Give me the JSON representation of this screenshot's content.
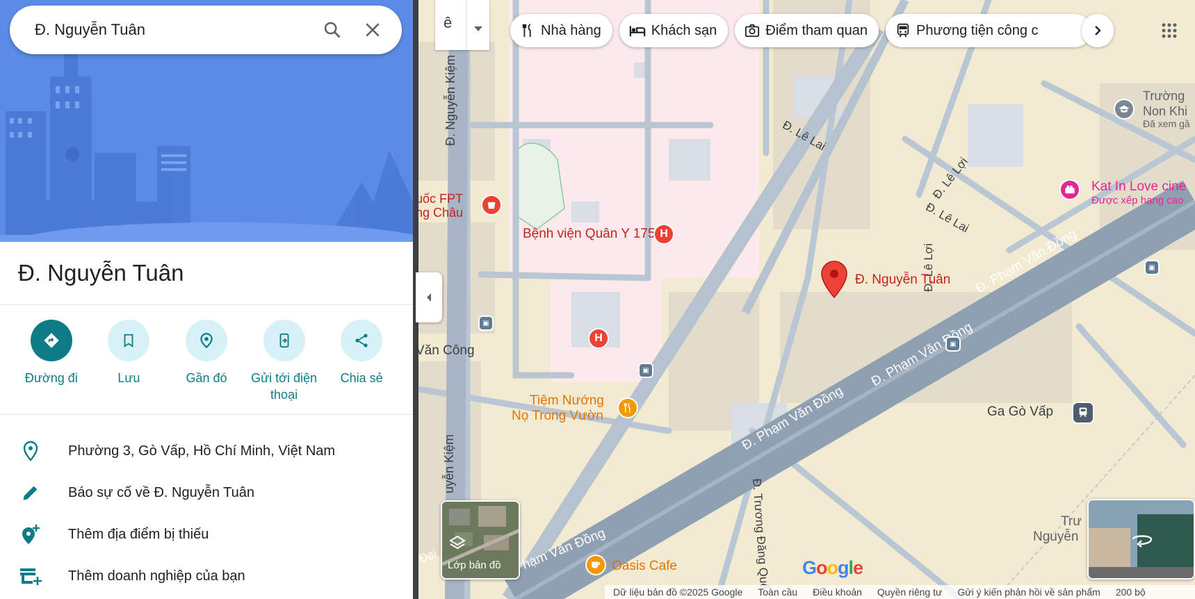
{
  "search": {
    "value": "Đ. Nguyễn Tuân",
    "icons": [
      "search-icon",
      "close-icon"
    ]
  },
  "place": {
    "title": "Đ. Nguyễn Tuân"
  },
  "actions": [
    {
      "label": "Đường đi",
      "icon": "directions-icon"
    },
    {
      "label": "Lưu",
      "icon": "bookmark-icon"
    },
    {
      "label": "Gần đó",
      "icon": "nearby-icon"
    },
    {
      "label": "Gửi tới điện thoại",
      "icon": "send-to-phone-icon"
    },
    {
      "label": "Chia sẻ",
      "icon": "share-icon"
    }
  ],
  "info": [
    {
      "text": "Phường 3, Gò Vấp, Hồ Chí Minh, Việt Nam",
      "icon": "location-pin-icon"
    },
    {
      "text": "Báo sự cố về Đ. Nguyễn Tuân",
      "icon": "pencil-icon"
    },
    {
      "text": "Thêm địa điểm bị thiếu",
      "icon": "add-place-icon"
    },
    {
      "text": "Thêm doanh nghiệp của bạn",
      "icon": "add-business-icon"
    }
  ],
  "map": {
    "language_button": "ê",
    "chips": [
      {
        "label": "Nhà hàng",
        "icon": "restaurant-icon"
      },
      {
        "label": "Khách sạn",
        "icon": "hotel-icon"
      },
      {
        "label": "Điểm tham quan",
        "icon": "camera-icon"
      },
      {
        "label": "Phương tiện công c",
        "icon": "transit-icon"
      }
    ],
    "layers_label": "Lớp bản đồ",
    "labels": {
      "nguyen_kiem_top": "Đ. Nguyễn Kiệm",
      "nguyen_kiem_bottom": "uyễn Kiệm",
      "le_lai_1": "Đ. Lê Lai",
      "le_lai_2": "Đ. Lê Lai",
      "le_loi_1": "Đ. Lê Lợi",
      "le_loi_2": "Đ. Lê Lợi",
      "pvd_1": "Đ. Phạm Văn Đồng",
      "pvd_2": "Đ. Phạm Văn Đồng",
      "pvd_3": "Đ. Phạm Văn Đồng",
      "pvd_4": "Đ. Phạm Văn Đồng",
      "pvd_5": "Đ. Phạm Văn Đồng",
      "truong_dang_que": "Đ. Trương Đăng Quế",
      "van_cong": "Văn Công",
      "dai": "Đại",
      "fpt_1": "uốc FPT",
      "fpt_2": "ng Châu",
      "hospital": "Bệnh viện Quân Y 175",
      "restaurant_1": "Tiệm Nướng",
      "restaurant_2": "Nọ Trong Vườn",
      "school_1": "Trường",
      "school_2": "Non Khi",
      "school_3": "Đã xem gầ",
      "cinema_1": "Kat In Love cine",
      "cinema_2": "Được xếp hạng cao",
      "station": "Ga Gò Vấp",
      "pin_label": "Đ. Nguyễn Tuân",
      "cafe": "Oasis Cafe",
      "tru_1": "Trư",
      "tru_2": "Nguyễn"
    },
    "footer": [
      "Dữ liệu bản đồ ©2025 Google",
      "Toàn cầu",
      "Điều khoản",
      "Quyền riêng tư",
      "Gửi ý kiến phản hồi về sản phẩm",
      "200 bộ"
    ],
    "logo": "Google"
  },
  "colors": {
    "accent": "#0e7c86",
    "pin": "#ea4335",
    "hero": "#5b8be6",
    "road": "#aab9c9",
    "major_road": "#8fa0b3"
  }
}
